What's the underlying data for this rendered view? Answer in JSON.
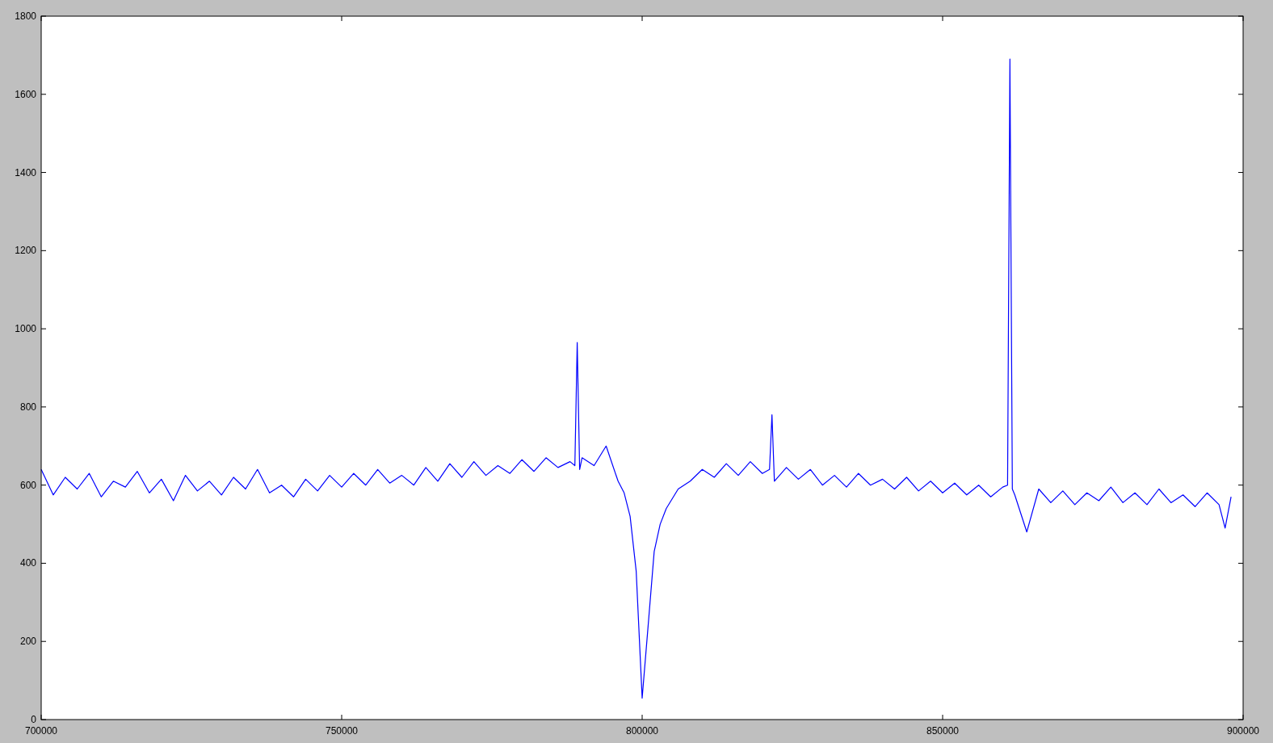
{
  "chart_data": {
    "type": "line",
    "xlim": [
      700000,
      900000
    ],
    "ylim": [
      0,
      1800
    ],
    "xticks": [
      700000,
      750000,
      800000,
      850000,
      900000
    ],
    "yticks": [
      0,
      200,
      400,
      600,
      800,
      1000,
      1200,
      1400,
      1600,
      1800
    ],
    "x": [
      700000,
      702000,
      704000,
      706000,
      708000,
      710000,
      712000,
      714000,
      716000,
      718000,
      720000,
      722000,
      724000,
      726000,
      728000,
      730000,
      732000,
      734000,
      736000,
      738000,
      740000,
      742000,
      744000,
      746000,
      748000,
      750000,
      752000,
      754000,
      756000,
      758000,
      760000,
      762000,
      764000,
      766000,
      768000,
      770000,
      772000,
      774000,
      776000,
      778000,
      780000,
      782000,
      784000,
      786000,
      788000,
      788800,
      789200,
      789600,
      790000,
      792000,
      794000,
      796000,
      797000,
      798000,
      799000,
      800000,
      801000,
      802000,
      803000,
      804000,
      806000,
      808000,
      810000,
      812000,
      814000,
      816000,
      818000,
      820000,
      821200,
      821600,
      822000,
      824000,
      826000,
      828000,
      830000,
      832000,
      834000,
      836000,
      838000,
      840000,
      842000,
      844000,
      846000,
      848000,
      850000,
      852000,
      854000,
      856000,
      858000,
      860000,
      860800,
      861200,
      861600,
      862000,
      864000,
      866000,
      868000,
      870000,
      872000,
      874000,
      876000,
      878000,
      880000,
      882000,
      884000,
      886000,
      888000,
      890000,
      892000,
      894000,
      896000,
      897000,
      898000
    ],
    "series": [
      {
        "color": "#0000ff",
        "values": [
          640,
          575,
          620,
          590,
          630,
          570,
          610,
          595,
          635,
          580,
          615,
          560,
          625,
          585,
          610,
          575,
          620,
          590,
          640,
          580,
          600,
          570,
          615,
          585,
          625,
          595,
          630,
          600,
          640,
          605,
          625,
          600,
          645,
          610,
          655,
          620,
          660,
          625,
          650,
          630,
          665,
          635,
          670,
          645,
          660,
          650,
          965,
          640,
          670,
          650,
          700,
          610,
          580,
          520,
          380,
          55,
          240,
          430,
          500,
          540,
          590,
          610,
          640,
          620,
          655,
          625,
          660,
          630,
          640,
          780,
          610,
          645,
          615,
          640,
          600,
          625,
          595,
          630,
          600,
          615,
          590,
          620,
          585,
          610,
          580,
          605,
          575,
          600,
          570,
          595,
          600,
          1690,
          590,
          575,
          480,
          590,
          555,
          585,
          550,
          580,
          560,
          595,
          555,
          580,
          550,
          590,
          555,
          575,
          545,
          580,
          550,
          490,
          570
        ]
      }
    ]
  }
}
